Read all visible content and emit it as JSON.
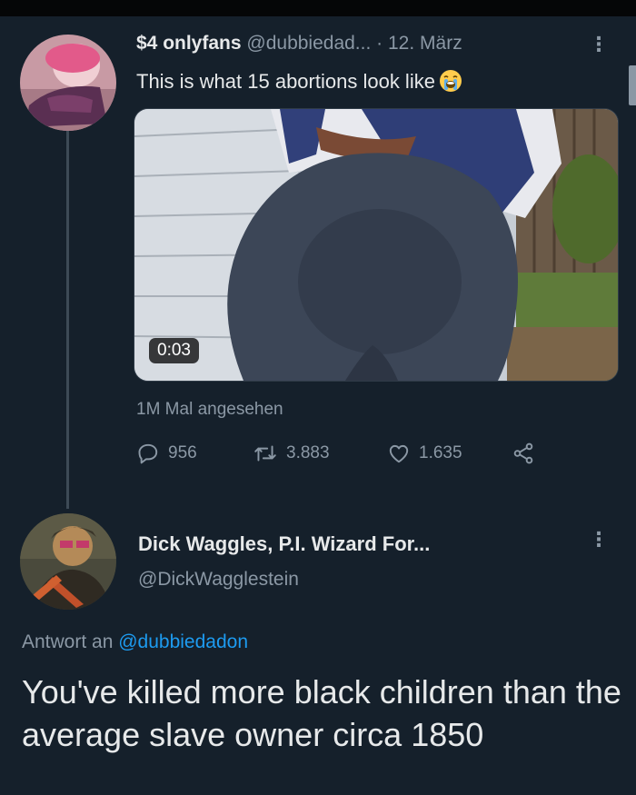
{
  "tweet": {
    "display_name": "$4 onlyfans",
    "handle": "@dubbiedad...",
    "separator": "·",
    "date": "12. März",
    "text": "This is what 15 abortions look like",
    "emoji": "loudly-crying-face",
    "video_duration": "0:03",
    "views": "1M Mal angesehen",
    "replies": "956",
    "retweets": "3.883",
    "likes": "1.635"
  },
  "reply": {
    "display_name": "Dick Waggles, P.I. Wizard For...",
    "handle": "@DickWagglestein",
    "reply_to_prefix": "Antwort an",
    "reply_to_handle": "@dubbiedadon",
    "text": "You've killed more black children than the average slave owner circa 1850"
  },
  "ui": {
    "more_icon": "more-vertical-icon",
    "icons": [
      "reply-icon",
      "retweet-icon",
      "like-icon",
      "share-icon"
    ]
  },
  "colors": {
    "background": "#15202b",
    "text_primary": "#e7e9ea",
    "text_secondary": "#8b98a5",
    "link": "#1d9bf0"
  }
}
